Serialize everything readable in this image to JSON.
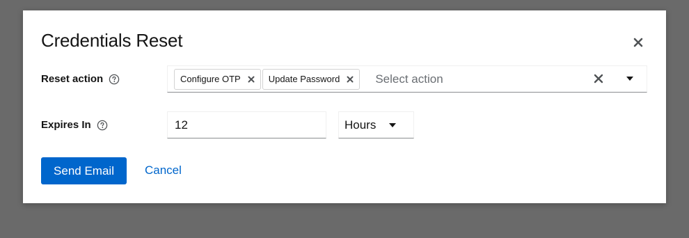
{
  "modal": {
    "title": "Credentials Reset"
  },
  "reset_action": {
    "label": "Reset action",
    "chips": [
      {
        "label": "Configure OTP"
      },
      {
        "label": "Update Password"
      }
    ],
    "placeholder": "Select action"
  },
  "expires": {
    "label": "Expires In",
    "value": "12",
    "unit": "Hours"
  },
  "actions": {
    "send_label": "Send Email",
    "cancel_label": "Cancel"
  },
  "icons": {
    "close": "close-icon",
    "help": "help-circle-icon",
    "chip_remove": "times-icon",
    "clear": "times-icon",
    "caret": "caret-down-icon"
  },
  "colors": {
    "primary": "#0066cc",
    "overlay": "#6a6a6a"
  }
}
